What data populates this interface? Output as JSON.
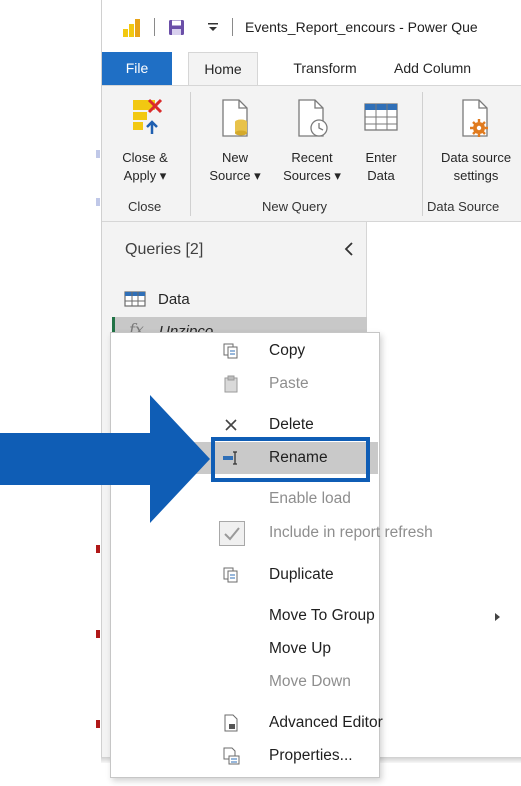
{
  "titlebar": {
    "title": "Events_Report_encours - Power Que",
    "qat_separator": "|"
  },
  "tabs": [
    {
      "label": "File",
      "active": false
    },
    {
      "label": "Home",
      "active": true
    },
    {
      "label": "Transform",
      "active": false
    },
    {
      "label": "Add Column",
      "active": false
    }
  ],
  "ribbon": {
    "buttons": [
      {
        "label": "Close &\nApply ▾",
        "icon": "close-apply-icon"
      },
      {
        "label": "New\nSource ▾",
        "icon": "new-source-icon"
      },
      {
        "label": "Recent\nSources ▾",
        "icon": "recent-sources-icon"
      },
      {
        "label": "Enter\nData",
        "icon": "enter-data-icon"
      },
      {
        "label": "Data source\nsettings",
        "icon": "data-source-settings-icon"
      }
    ],
    "groups": [
      {
        "label": "Close"
      },
      {
        "label": "New Query"
      },
      {
        "label": "Data Source"
      }
    ]
  },
  "queries_pane": {
    "title": "Queries [2]",
    "items": [
      {
        "label": "Data",
        "icon": "table-icon"
      },
      {
        "label": "Unzipco...",
        "icon": "function-icon",
        "selected": true
      }
    ]
  },
  "context_menu": {
    "items": [
      {
        "label": "Copy",
        "icon": "copy-icon",
        "enabled": true
      },
      {
        "label": "Paste",
        "icon": "paste-icon",
        "enabled": false
      },
      {
        "label": "Delete",
        "icon": "delete-icon",
        "enabled": true
      },
      {
        "label": "Rename",
        "icon": "rename-icon",
        "enabled": true,
        "highlighted": true
      },
      {
        "label": "Enable load",
        "icon": "",
        "enabled": false
      },
      {
        "label": "Include in report refresh",
        "icon": "checkbox-icon",
        "enabled": false,
        "checked": true
      },
      {
        "label": "Duplicate",
        "icon": "duplicate-icon",
        "enabled": true
      },
      {
        "label": "Move To Group",
        "icon": "",
        "enabled": true,
        "submenu": true
      },
      {
        "label": "Move Up",
        "icon": "",
        "enabled": true
      },
      {
        "label": "Move Down",
        "icon": "",
        "enabled": false
      },
      {
        "label": "Advanced Editor",
        "icon": "advanced-editor-icon",
        "enabled": true
      },
      {
        "label": "Properties...",
        "icon": "properties-icon",
        "enabled": true
      }
    ]
  },
  "annotation": {
    "arrow_color": "#0f5db5",
    "highlight_target": "Rename"
  },
  "colors": {
    "file_tab": "#1f6fc5",
    "ribbon_bg": "#f3f3f3",
    "selected_query": "#c8c8c8",
    "menu_highlight": "#c9c9c9"
  }
}
